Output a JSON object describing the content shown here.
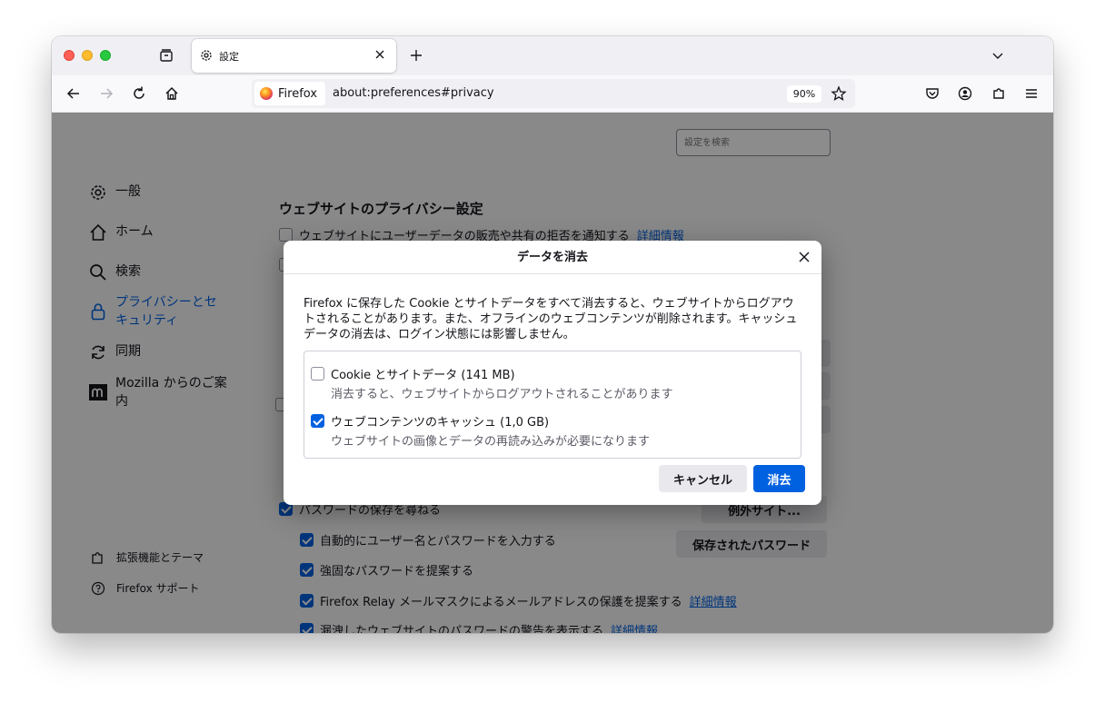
{
  "tab": {
    "title": "設定"
  },
  "urlbar": {
    "identity": "Firefox",
    "url": "about:preferences#privacy",
    "zoom": "90%"
  },
  "search": {
    "placeholder": "設定を検索"
  },
  "sidebar": {
    "categories": [
      {
        "label": "一般",
        "icon": "gear-icon"
      },
      {
        "label": "ホーム",
        "icon": "home-icon"
      },
      {
        "label": "検索",
        "icon": "search-icon"
      },
      {
        "label": "プライバシーとセキュリティ",
        "label_line1": "プライバシーとセ",
        "label_line2": "キュリティ",
        "icon": "lock-icon",
        "selected": true
      },
      {
        "label": "同期",
        "icon": "sync-icon"
      },
      {
        "label": "Mozilla からのご案内",
        "label_line1": "Mozilla からのご案",
        "label_line2": "内",
        "icon": "mozilla-icon"
      }
    ],
    "footer": [
      {
        "label": "拡張機能とテーマ",
        "icon": "puzzle-icon"
      },
      {
        "label": "Firefox サポート",
        "icon": "help-icon"
      }
    ]
  },
  "privacy": {
    "heading": "ウェブサイトのプライバシー設定",
    "gpc_label": "ウェブサイトにユーザーデータの販売や共有の拒否を通知する",
    "learn_more": "詳細情報"
  },
  "passwords": {
    "ask_to_save": "パスワードの保存を尋ねる",
    "exceptions_button": "例外サイト...",
    "saved_button": "保存されたパスワード",
    "autofill": "自動的にユーザー名とパスワードを入力する",
    "suggest_strong": "強固なパスワードを提案する",
    "relay": "Firefox Relay メールマスクによるメールアドレスの保護を提案する",
    "relay_link": "詳細情報",
    "breach": "漏洩したウェブサイトのパスワードの警告を表示する",
    "breach_link": "詳細情報"
  },
  "dialog": {
    "title": "データを消去",
    "description": "Firefox に保存した Cookie とサイトデータをすべて消去すると、ウェブサイトからログアウトされることがあります。また、オフラインのウェブコンテンツが削除されます。キャッシュデータの消去は、ログイン状態には影響しません。",
    "options": [
      {
        "label": "Cookie とサイトデータ (141 MB)",
        "description": "消去すると、ウェブサイトからログアウトされることがあります",
        "checked": false
      },
      {
        "label": "ウェブコンテンツのキャッシュ (1,0 GB)",
        "description": "ウェブサイトの画像とデータの再読み込みが必要になります",
        "checked": true
      }
    ],
    "cancel_button": "キャンセル",
    "clear_button": "消去"
  },
  "colors": {
    "accent": "#0061e0",
    "overlay": "rgba(0,0,0,0.45)"
  }
}
